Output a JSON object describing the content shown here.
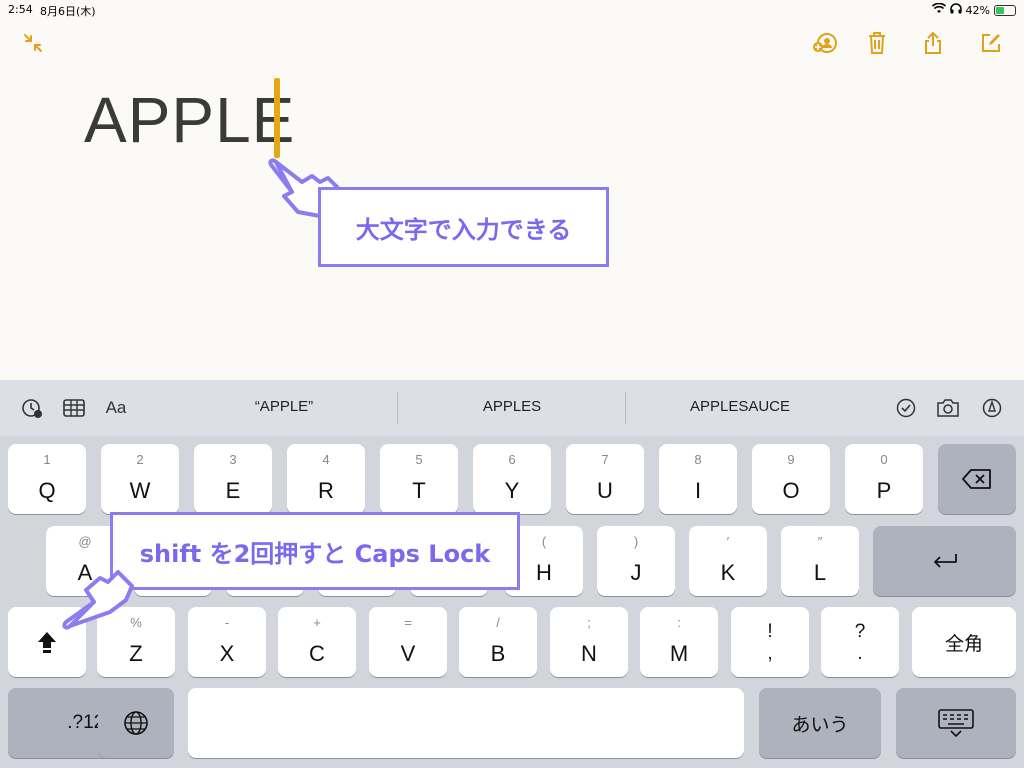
{
  "status_bar": {
    "time": "2:54",
    "date": "8月6日(木)",
    "battery": "42%"
  },
  "note": {
    "text": "APPLE"
  },
  "annotations": {
    "caps_text": "大文字で入力できる",
    "shift_text": "shift を2回押すと Caps Lock"
  },
  "suggestions": [
    "“APPLE”",
    "APPLES",
    "APPLESAUCE"
  ],
  "toolbar_labels": {
    "format": "Aa"
  },
  "keyboard": {
    "row1": [
      {
        "main": "Q",
        "sub": "1"
      },
      {
        "main": "W",
        "sub": "2"
      },
      {
        "main": "E",
        "sub": "3"
      },
      {
        "main": "R",
        "sub": "4"
      },
      {
        "main": "T",
        "sub": "5"
      },
      {
        "main": "Y",
        "sub": "6"
      },
      {
        "main": "U",
        "sub": "7"
      },
      {
        "main": "I",
        "sub": "8"
      },
      {
        "main": "O",
        "sub": "9"
      },
      {
        "main": "P",
        "sub": "0"
      }
    ],
    "row2": [
      {
        "main": "A",
        "sub": "@"
      },
      {
        "main": "H",
        "sub": "("
      },
      {
        "main": "J",
        "sub": ")"
      },
      {
        "main": "K",
        "sub": "′"
      },
      {
        "main": "L",
        "sub": "″"
      }
    ],
    "row3": [
      {
        "main": "Z",
        "sub": "%"
      },
      {
        "main": "X",
        "sub": "-"
      },
      {
        "main": "C",
        "sub": "+"
      },
      {
        "main": "V",
        "sub": "="
      },
      {
        "main": "B",
        "sub": "/"
      },
      {
        "main": "N",
        "sub": ";"
      },
      {
        "main": "M",
        "sub": ":"
      },
      {
        "main": ",",
        "sub": "!"
      },
      {
        "main": ".",
        "sub": "?"
      }
    ],
    "zenkaku": "全角",
    "numbers": ".?123",
    "hiragana": "あいう"
  },
  "colors": {
    "accent": "#e3a814",
    "annotation": "#8b7cf0"
  }
}
